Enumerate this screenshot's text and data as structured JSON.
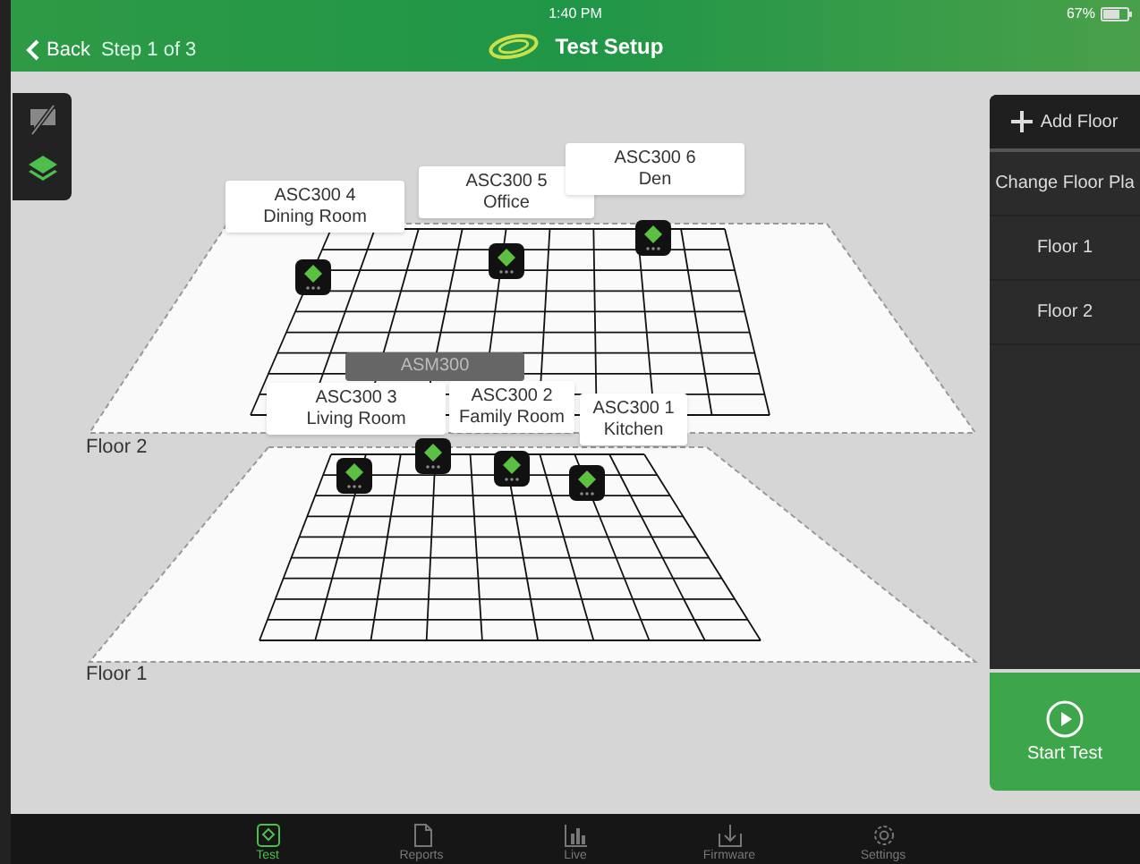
{
  "header": {
    "back": "Back",
    "step": "Step 1 of 3",
    "time": "1:40 PM",
    "title": "Test Setup",
    "battery": "67%"
  },
  "canvas": {
    "floors": [
      {
        "label": "Floor 2"
      },
      {
        "label": "Floor 1"
      }
    ],
    "devices": [
      {
        "kind": "callout",
        "model": "ASC300 4",
        "room": "Dining Room"
      },
      {
        "kind": "callout",
        "model": "ASC300 5",
        "room": "Office"
      },
      {
        "kind": "callout",
        "model": "ASC300 6",
        "room": "Den"
      },
      {
        "kind": "muted",
        "model": "ASM300"
      },
      {
        "kind": "callout",
        "model": "ASC300 3",
        "room": "Living Room"
      },
      {
        "kind": "callout",
        "model": "ASC300 2",
        "room": "Family Room"
      },
      {
        "kind": "callout",
        "model": "ASC300 1",
        "room": "Kitchen"
      }
    ]
  },
  "side_panel": {
    "add_floor": "Add Floor",
    "change_plan": "Change Floor Pla",
    "floors": [
      "Floor 1",
      "Floor 2"
    ],
    "start": "Start Test"
  },
  "tab_bar": [
    {
      "label": "Test",
      "selected": true
    },
    {
      "label": "Reports",
      "selected": false
    },
    {
      "label": "Live",
      "selected": false
    },
    {
      "label": "Firmware",
      "selected": false
    },
    {
      "label": "Settings",
      "selected": false
    }
  ]
}
